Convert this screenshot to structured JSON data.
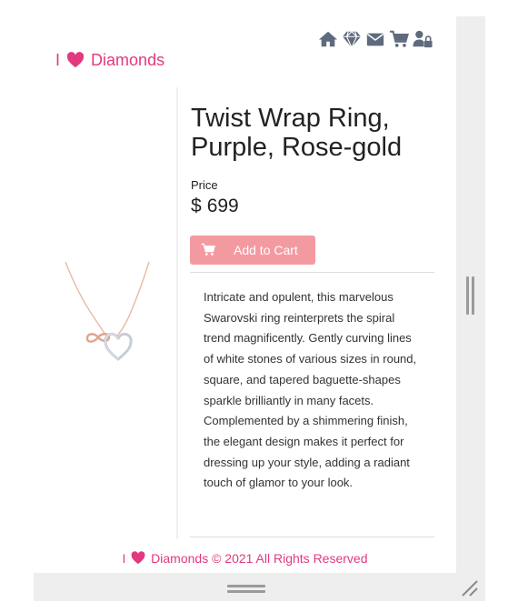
{
  "colors": {
    "brand": "#e2397f",
    "button": "#f39aa1",
    "nav_icon": "#5f6b7d"
  },
  "nav": {
    "items": [
      {
        "icon": "home-icon"
      },
      {
        "icon": "diamond-icon"
      },
      {
        "icon": "envelope-icon"
      },
      {
        "icon": "shopping-cart-icon"
      },
      {
        "icon": "user-lock-icon"
      }
    ]
  },
  "brand": {
    "prefix": "I",
    "heart_icon": "heart-icon",
    "name": "Diamonds"
  },
  "product": {
    "title": "Twist Wrap Ring, Purple, Rose-gold",
    "price_label": "Price",
    "currency": "$",
    "price": "699",
    "add_to_cart_label": "Add to Cart",
    "description": "Intricate and opulent, this marvelous Swarovski ring reinterprets the spiral trend magnificently. Gently curving lines of white stones of various sizes in round, square, and tapered baguette-shapes sparkle brilliantly in many facets. Complemented by a shimmering finish, the elegant design makes it perfect for dressing up your style, adding a radiant touch of glamor to your look."
  },
  "footer": {
    "prefix": "I",
    "text": "Diamonds © 2021 All Rights Reserved"
  }
}
